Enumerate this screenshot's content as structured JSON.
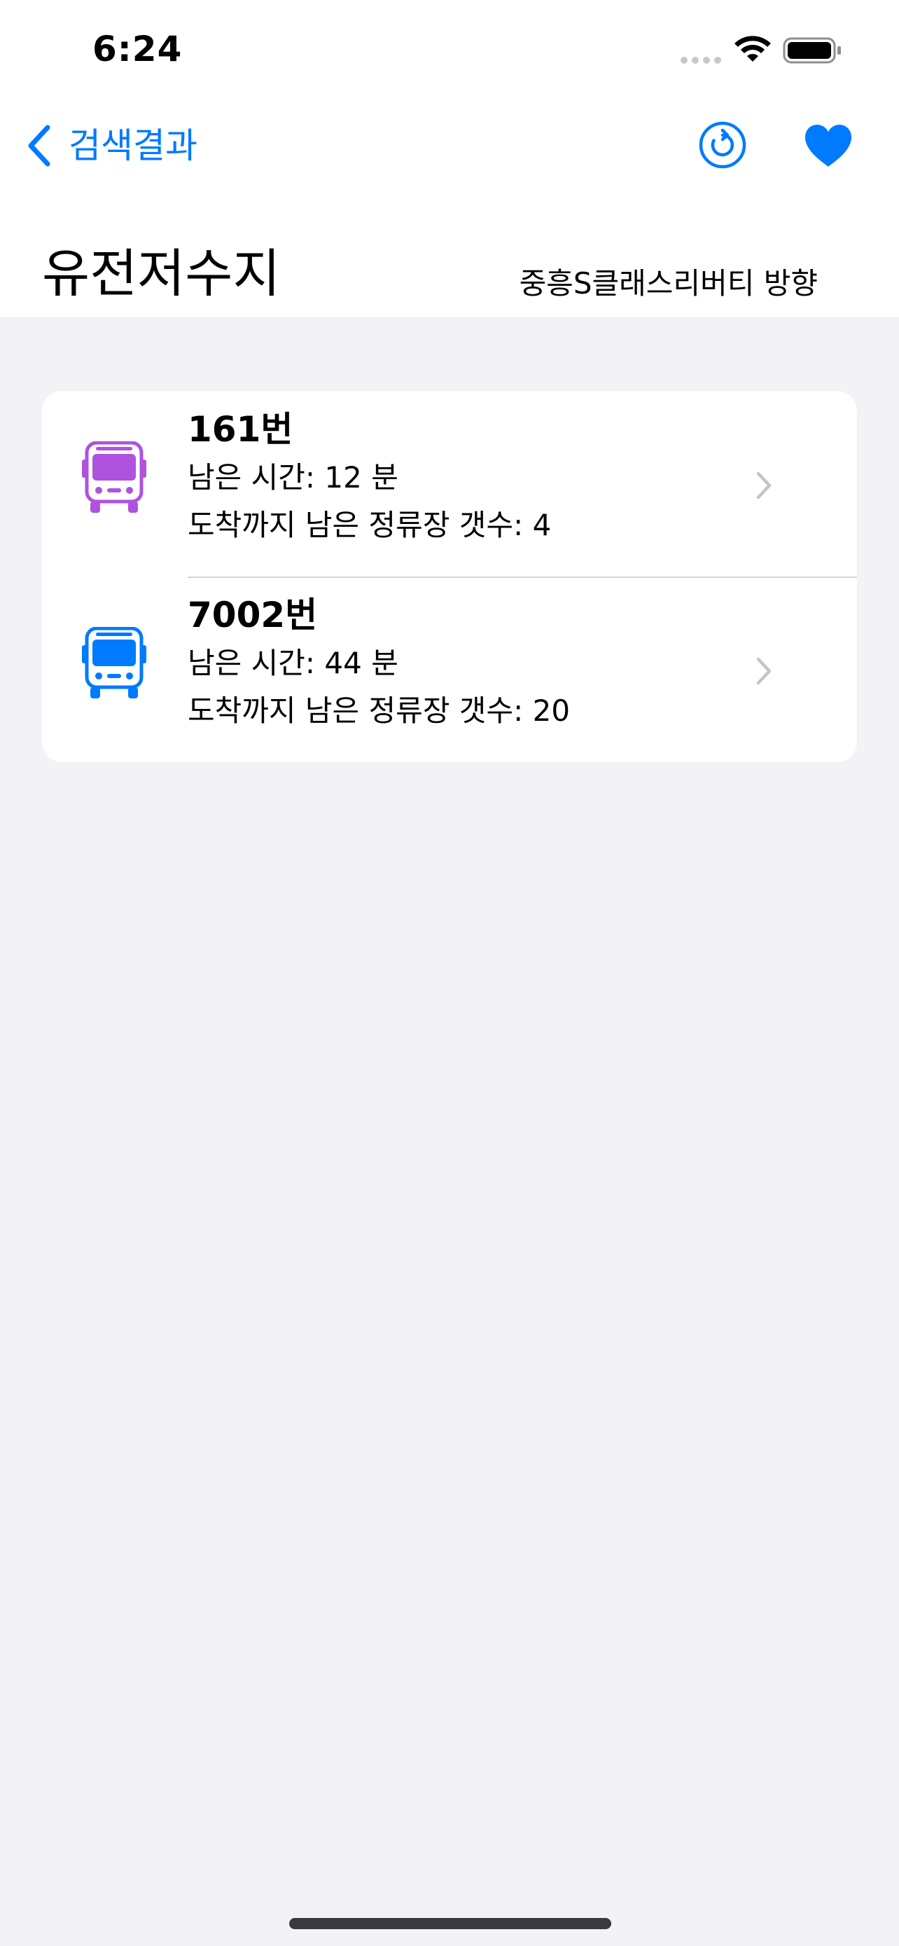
{
  "status_bar": {
    "time": "6:24"
  },
  "nav": {
    "back_label": "검색결과",
    "icons": {
      "back": "chevron-left-icon",
      "refresh": "arrow-clockwise-circle-icon",
      "favorite": "heart-fill-icon"
    },
    "accent_color": "#007AFF"
  },
  "station": {
    "name": "유전저수지",
    "direction": "중흥S클래스리버티 방향"
  },
  "routes": [
    {
      "number": "161번",
      "remaining_time": "남은 시간: 12 분",
      "remaining_stops": "도착까지 남은 정류장 갯수: 4",
      "icon": "bus-icon",
      "color": "#AF52DE"
    },
    {
      "number": "7002번",
      "remaining_time": "남은 시간: 44 분",
      "remaining_stops": "도착까지 남은 정류장 갯수: 20",
      "icon": "bus-icon",
      "color": "#007AFF"
    }
  ]
}
